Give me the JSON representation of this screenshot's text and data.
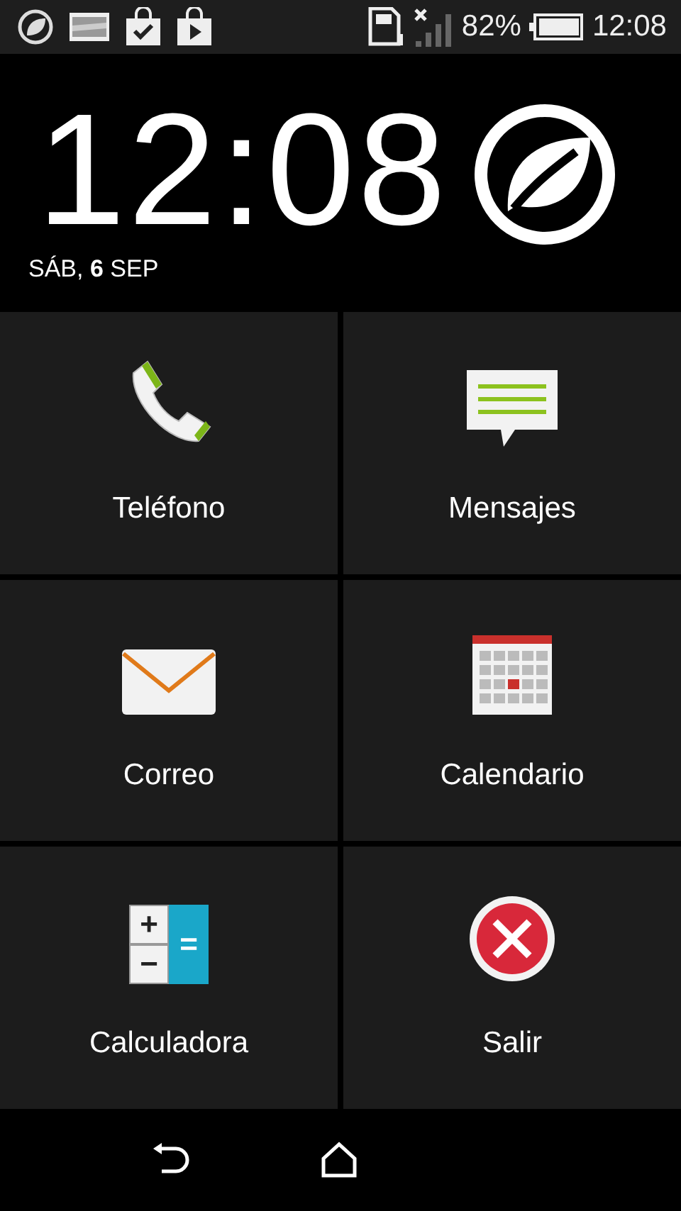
{
  "status_bar": {
    "battery_text": "82%",
    "time": "12:08"
  },
  "header": {
    "clock": "12:08",
    "date": "SÁB, **6** SEP"
  },
  "tiles": [
    {
      "kind": "phone",
      "label": "Teléfono"
    },
    {
      "kind": "messages",
      "label": "Mensajes"
    },
    {
      "kind": "mail",
      "label": "Correo"
    },
    {
      "kind": "calendar",
      "label": "Calendario"
    },
    {
      "kind": "calculator",
      "label": "Calculadora",
      "keys": [
        "+",
        "−",
        "="
      ]
    },
    {
      "kind": "exit",
      "label": "Salir"
    }
  ]
}
